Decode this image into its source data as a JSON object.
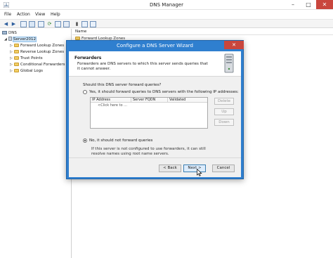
{
  "window": {
    "title": "DNS Manager",
    "controls": {
      "minimize": "–",
      "maximize": "□",
      "close": "✕"
    }
  },
  "menu": [
    "File",
    "Action",
    "View",
    "Help"
  ],
  "toolbar": {
    "icons": [
      "back-arrow-icon",
      "forward-arrow-icon",
      "folder-up-icon",
      "console-tree-icon",
      "properties-icon",
      "refresh-icon",
      "export-icon",
      "help-icon",
      "server-icon",
      "record-icon",
      "record-alt-icon"
    ]
  },
  "tree": {
    "root": "DNS",
    "server": "Server2012",
    "items": [
      "Forward Lookup Zones",
      "Reverse Lookup Zones",
      "Trust Points",
      "Conditional Forwarders",
      "Global Logs"
    ]
  },
  "list": {
    "column": "Name",
    "first_row": "Forward Lookup Zones"
  },
  "wizard": {
    "title": "Configure a DNS Server Wizard",
    "close": "✕",
    "heading": "Forwarders",
    "description": "Forwarders are DNS servers to which this server sends queries that it cannot answer.",
    "question": "Should this DNS server forward queries?",
    "option_yes": "Yes, it should forward queries to DNS servers with the following IP addresses:",
    "option_no": "No, it should not forward queries",
    "selected_option": "no",
    "grid_columns": [
      "IP Address",
      "Server FQDN",
      "Validated"
    ],
    "grid_placeholder": "<Click here to ...",
    "side_buttons": {
      "delete": "Delete",
      "up": "Up",
      "down": "Down"
    },
    "note": "If this server is not configured to use forwarders, it can still resolve names using root name servers.",
    "buttons": {
      "back": "< Back",
      "next": "Next >",
      "cancel": "Cancel"
    }
  }
}
